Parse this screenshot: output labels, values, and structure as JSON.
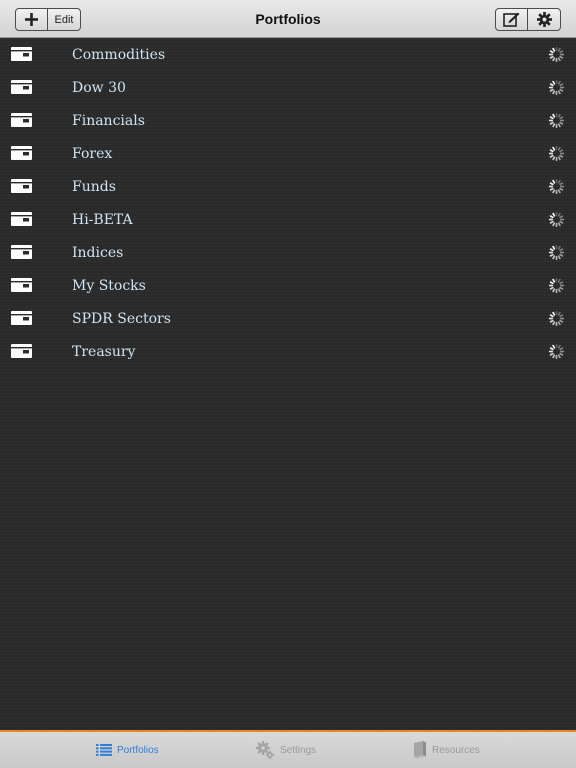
{
  "navbar": {
    "title": "Portfolios",
    "edit_label": "Edit",
    "add_icon": "plus-icon",
    "compose_icon": "compose-icon",
    "settings_icon": "gear-icon"
  },
  "portfolios": [
    {
      "label": "Commodities"
    },
    {
      "label": "Dow 30"
    },
    {
      "label": "Financials"
    },
    {
      "label": "Forex"
    },
    {
      "label": "Funds"
    },
    {
      "label": "Hi-BETA"
    },
    {
      "label": "Indices"
    },
    {
      "label": "My Stocks"
    },
    {
      "label": "SPDR Sectors"
    },
    {
      "label": "Treasury"
    }
  ],
  "tabbar": {
    "tabs": [
      {
        "label": "Portfolios",
        "icon": "list-icon",
        "active": true
      },
      {
        "label": "Settings",
        "icon": "gears-icon",
        "active": false
      },
      {
        "label": "Resources",
        "icon": "book-icon",
        "active": false
      }
    ]
  },
  "colors": {
    "accent": "#e3892b",
    "active_tab": "#2f7fd6",
    "list_text": "#cfe4f2",
    "background": "#2b2b2b"
  }
}
